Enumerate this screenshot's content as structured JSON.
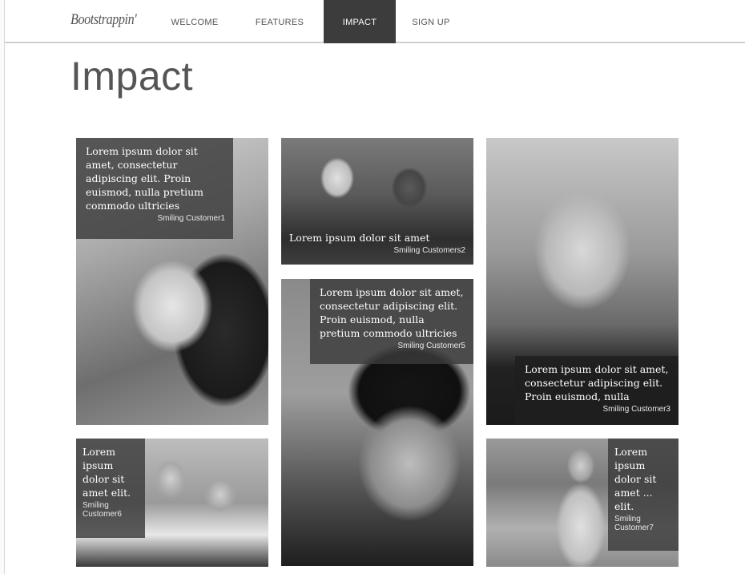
{
  "navbar": {
    "brand": "Bootstrappin'",
    "items": [
      {
        "label": "WELCOME",
        "active": false
      },
      {
        "label": "FEATURES",
        "active": false
      },
      {
        "label": "IMPACT",
        "active": true
      },
      {
        "label": "SIGN UP",
        "active": false
      }
    ]
  },
  "page": {
    "title": "Impact"
  },
  "tiles": [
    {
      "quote": "Lorem ipsum dolor sit amet, consectetur adipiscing elit. Proin euismod, nulla pretium commodo ultricies",
      "name": "Smiling Customer1"
    },
    {
      "quote": "Lorem ipsum dolor sit amet",
      "name": "Smiling Customers2"
    },
    {
      "quote": "Lorem ipsum dolor sit amet, consectetur adipiscing elit. Proin euismod, nulla",
      "name": "Smiling Customer3"
    },
    {
      "quote": "Lorem ipsum dolor sit amet, consectetur adipiscing elit. Proin euismod, nulla pretium commodo ultricies",
      "name": "Smiling Customer5"
    },
    {
      "quote": "Lorem ipsum dolor sit amet elit.",
      "name": "Smiling Customer6"
    },
    {
      "quote": "Lorem ipsum dolor sit amet ... elit.",
      "name": "Smiling Customer7"
    }
  ],
  "colors": {
    "nav_active_bg": "#3c3c3c",
    "caption_bg": "#3a3a3a",
    "title_text": "#555555"
  }
}
